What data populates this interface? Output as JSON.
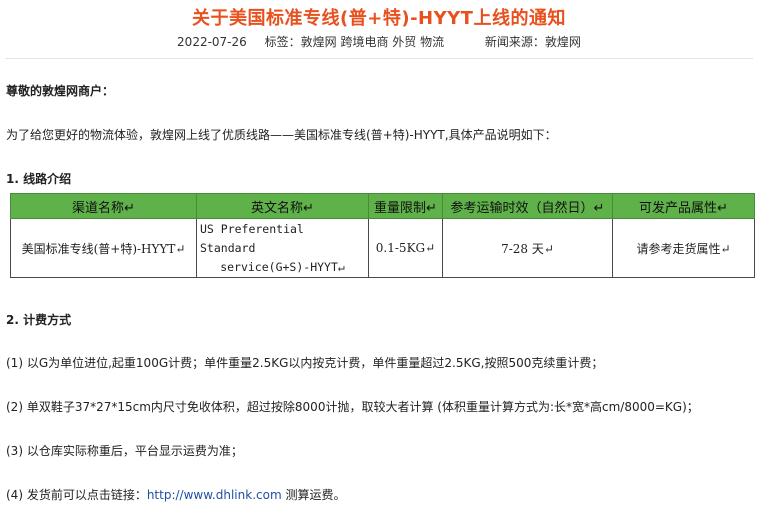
{
  "article": {
    "title": "关于美国标准专线(普+特)-HYYT上线的通知",
    "date": "2022-07-26",
    "tags_label": "标签：",
    "tags": "敦煌网 跨境电商 外贸 物流",
    "source": "新闻来源：敦煌网"
  },
  "body": {
    "greeting": "尊敬的敦煌网商户：",
    "intro": "为了给您更好的物流体验，敦煌网上线了优质线路——美国标准专线(普+特)-HYYT,具体产品说明如下：",
    "section1_title": "1. 线路介绍",
    "section2_title": "2. 计费方式",
    "rule1": "(1) 以G为单位进位,起重100G计费；单件重量2.5KG以内按克计费，单件重量超过2.5KG,按照500克续重计费；",
    "rule2": "(2) 单双鞋子37*27*15cm内尺寸免收体积，超过按除8000计抛，取较大者计算 (体积重量计算方式为:长*宽*高cm/8000=KG)；",
    "rule3": "(3) 以仓库实际称重后，平台显示运费为准；",
    "rule4_prefix": "(4) 发货前可以点击链接：",
    "rule4_link": "http://www.dhlink.com",
    "rule4_suffix": " 测算运费。"
  },
  "table": {
    "headers": [
      "渠道名称↵",
      "英文名称↵",
      "重量限制↵",
      "参考运输时效（自然日）↵",
      "可发产品属性↵"
    ],
    "row": {
      "channel": "美国标准专线(普+特)-HYYT↵",
      "english_line1": "US Preferential Standard",
      "english_line2": "service(G+S)-HYYT↵",
      "weight": "0.1-5KG↵",
      "time": "7-28 天↵",
      "attribute": "请参考走货属性↵"
    }
  }
}
